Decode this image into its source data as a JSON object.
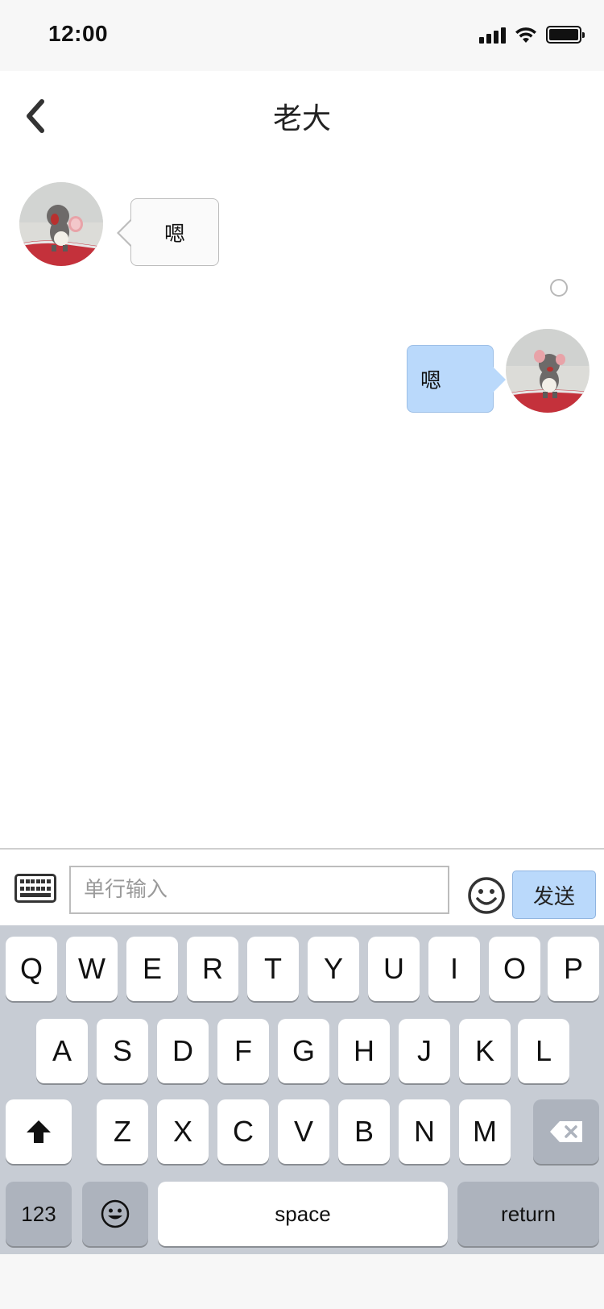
{
  "status_bar": {
    "time": "12:00",
    "icons": [
      "signal-icon",
      "wifi-icon",
      "battery-icon"
    ]
  },
  "nav": {
    "title": "老大",
    "back_icon": "chevron-left-icon"
  },
  "messages": [
    {
      "side": "left",
      "text": "嗯",
      "avatar": "avatar"
    },
    {
      "side": "right",
      "text": "嗯",
      "avatar": "avatar",
      "status": "unread"
    }
  ],
  "input_bar": {
    "keyboard_icon": "keyboard-icon",
    "placeholder": "单行输入",
    "emoji_icon": "smiley-icon",
    "send_label": "发送"
  },
  "keyboard": {
    "row1": [
      "Q",
      "W",
      "E",
      "R",
      "T",
      "Y",
      "U",
      "I",
      "O",
      "P"
    ],
    "row2": [
      "A",
      "S",
      "D",
      "F",
      "G",
      "H",
      "J",
      "K",
      "L"
    ],
    "row3": [
      "Z",
      "X",
      "C",
      "V",
      "B",
      "N",
      "M"
    ],
    "shift_icon": "shift-arrow-icon",
    "delete_icon": "backspace-icon",
    "numbers_label": "123",
    "emoji_icon": "smiley-icon",
    "space_label": "space",
    "return_label": "return"
  },
  "colors": {
    "accent_bubble": "#bad9fb",
    "keyboard_bg": "#c7ccd4",
    "status_bg": "#f7f7f7"
  }
}
